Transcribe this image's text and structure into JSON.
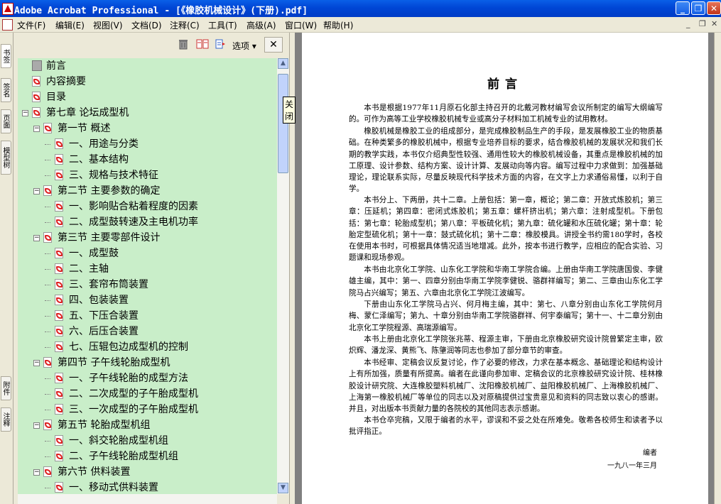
{
  "window": {
    "title": "Adobe Acrobat Professional - [《橡胶机械设计》(下册).pdf]"
  },
  "menu": [
    "文件(F)",
    "编辑(E)",
    "视图(V)",
    "文档(D)",
    "注释(C)",
    "工具(T)",
    "高级(A)",
    "窗口(W)",
    "帮助(H)"
  ],
  "side_tabs": [
    "书签",
    "签名",
    "页面",
    "模型树",
    "附件",
    "注释"
  ],
  "panel": {
    "options_label": "选项 ▾",
    "close_glyph": "✕",
    "tooltip": "关闭"
  },
  "bookmarks": [
    {
      "label": "前言",
      "level": 0,
      "icon": "page-gray-icon",
      "expander": ""
    },
    {
      "label": "内容摘要",
      "level": 0,
      "icon": "pdf-bookmark-icon",
      "expander": ""
    },
    {
      "label": "目录",
      "level": 0,
      "icon": "pdf-bookmark-icon",
      "expander": ""
    },
    {
      "label": "第七章 论坛成型机",
      "level": 0,
      "icon": "pdf-bookmark-icon",
      "expander": "−"
    },
    {
      "label": "第一节 概述",
      "level": 1,
      "icon": "pdf-bookmark-icon",
      "expander": "−"
    },
    {
      "label": "一、用途与分类",
      "level": 2,
      "icon": "pdf-bookmark-icon",
      "expander": ""
    },
    {
      "label": "二、基本结构",
      "level": 2,
      "icon": "pdf-bookmark-icon",
      "expander": ""
    },
    {
      "label": "三、规格与技术特征",
      "level": 2,
      "icon": "pdf-bookmark-icon",
      "expander": ""
    },
    {
      "label": "第二节 主要参数的确定",
      "level": 1,
      "icon": "pdf-bookmark-icon",
      "expander": "−"
    },
    {
      "label": "一、影响贴合粘着程度的因素",
      "level": 2,
      "icon": "pdf-bookmark-icon",
      "expander": ""
    },
    {
      "label": "二、成型鼓转速及主电机功率",
      "level": 2,
      "icon": "pdf-bookmark-icon",
      "expander": ""
    },
    {
      "label": "第三节 主要零部件设计",
      "level": 1,
      "icon": "pdf-bookmark-icon",
      "expander": "−"
    },
    {
      "label": "一、成型鼓",
      "level": 2,
      "icon": "pdf-bookmark-icon",
      "expander": ""
    },
    {
      "label": "二、主轴",
      "level": 2,
      "icon": "pdf-bookmark-icon",
      "expander": ""
    },
    {
      "label": "三、套帘布筒装置",
      "level": 2,
      "icon": "pdf-bookmark-icon",
      "expander": ""
    },
    {
      "label": "四、包装装置",
      "level": 2,
      "icon": "pdf-bookmark-icon",
      "expander": ""
    },
    {
      "label": "五、下压合装置",
      "level": 2,
      "icon": "pdf-bookmark-icon",
      "expander": ""
    },
    {
      "label": "六、后压合装置",
      "level": 2,
      "icon": "pdf-bookmark-icon",
      "expander": ""
    },
    {
      "label": "七、压辊包边成型机的控制",
      "level": 2,
      "icon": "pdf-bookmark-icon",
      "expander": ""
    },
    {
      "label": "第四节 子午线轮胎成型机",
      "level": 1,
      "icon": "pdf-bookmark-icon",
      "expander": "−"
    },
    {
      "label": "一、子午线轮胎的成型方法",
      "level": 2,
      "icon": "pdf-bookmark-icon",
      "expander": ""
    },
    {
      "label": "二、二次成型的子午胎成型机",
      "level": 2,
      "icon": "pdf-bookmark-icon",
      "expander": ""
    },
    {
      "label": "三、一次成型的子午胎成型机",
      "level": 2,
      "icon": "pdf-bookmark-icon",
      "expander": ""
    },
    {
      "label": "第五节 轮胎成型机组",
      "level": 1,
      "icon": "pdf-bookmark-icon",
      "expander": "−"
    },
    {
      "label": "一、斜交轮胎成型机组",
      "level": 2,
      "icon": "pdf-bookmark-icon",
      "expander": ""
    },
    {
      "label": "二、子午线轮胎成型机组",
      "level": 2,
      "icon": "pdf-bookmark-icon",
      "expander": ""
    },
    {
      "label": "第六节 供料装置",
      "level": 1,
      "icon": "pdf-bookmark-icon",
      "expander": "−"
    },
    {
      "label": "一、移动式供料装置",
      "level": 2,
      "icon": "pdf-bookmark-icon",
      "expander": ""
    }
  ],
  "document": {
    "title": "前言",
    "paragraphs": [
      "本书是根据1977年11月原石化部主持召开的北戴河教材编写会议所制定的编写大纲编写的。可作为高等工业学校橡胶机械专业或高分子材料加工机械专业的试用教材。",
      "橡胶机械是橡胶工业的组成部分，是完成橡胶制品生产的手段，是发展橡胶工业的物质基础。在种类繁多的橡胶机械中，根据专业培养目标的要求，结合橡胶机械的发展状况和我们长期的教学实践，本书仅介绍典型性较强、通用性较大的橡胶机械设备，其重点是橡胶机械的加工原理、设计参数、结构方案、设计计算、发展动向等内容。编写过程中力求做到：加强基础理论，理论联系实际，尽量反映现代科学技术方面的内容，在文字上力求通俗易懂，以利于自学。",
      "本书分上、下两册，共十二章。上册包括：第一章，概论；第二章：开放式炼胶机；第三章：压延机；第四章：密闭式炼胶机；第五章：螺杆挤出机；第六章：注射成型机。下册包括：第七章：轮胎成型机；第八章：平板硫化机；第九章：硫化罐和水压硫化罐；第十章：轮胎定型硫化机；第十一章：鼓式硫化机；第十二章：橡胶模具。讲授全书约需180学时，各校在使用本书时，可根据具体情况适当地增减。此外，按本书进行教学，应相应的配合实验、习题课和现场参观。",
      "本书由北京化工学院、山东化工学院和华南工学院合编。上册由华南工学院唐国俊、李健雄主编，其中：第一、四章分别由华南工学院李健锐、骆群祥编写；第二、三章由山东化工学院马占兴编写；第五、六章由北京化工学院江波编写。",
      "下册由山东化工学院马占兴、何月梅主编，其中：第七、八章分别由山东化工学院何月梅、蒙仁泽编写；第九、十章分别由华南工学院骆群祥、何宇泰编写；第十一、十二章分别由北京化工学院程源、高瑞源编写。",
      "本书上册由北京化工学院张兆蒂、程源主审，下册由北京橡胶研究设计院曾繁定主审，欧炽辉、潘龙深、黄熊飞、陈肇润等同志也参加了部分章节的审查。",
      "本书经审、定稿会议反复讨论，作了必要的修改，力求在基本概念、基础理论和结构设计上有所加强，质量有所提高。编者在此谨向参加审、定稿会议的北京橡胶研究设计院、桂林橡胶设计研究院、大连橡胶塑料机械厂、沈阳橡胶机械厂、益阳橡胶机械厂、上海橡胶机械厂、上海第一橡胶机械厂等单位的同志以及对原稿提供过宝贵意见和资料的同志致以衷心的感谢。并且，对出版本书贡献力量的各院校的其他同志表示感谢。",
      "本书仓卒完稿，又限于编者的水平，谬误和不妥之处在所难免。敬希各校师生和读者予以批评指正。"
    ],
    "signature_author": "编者",
    "signature_date": "一九八一年三月"
  }
}
